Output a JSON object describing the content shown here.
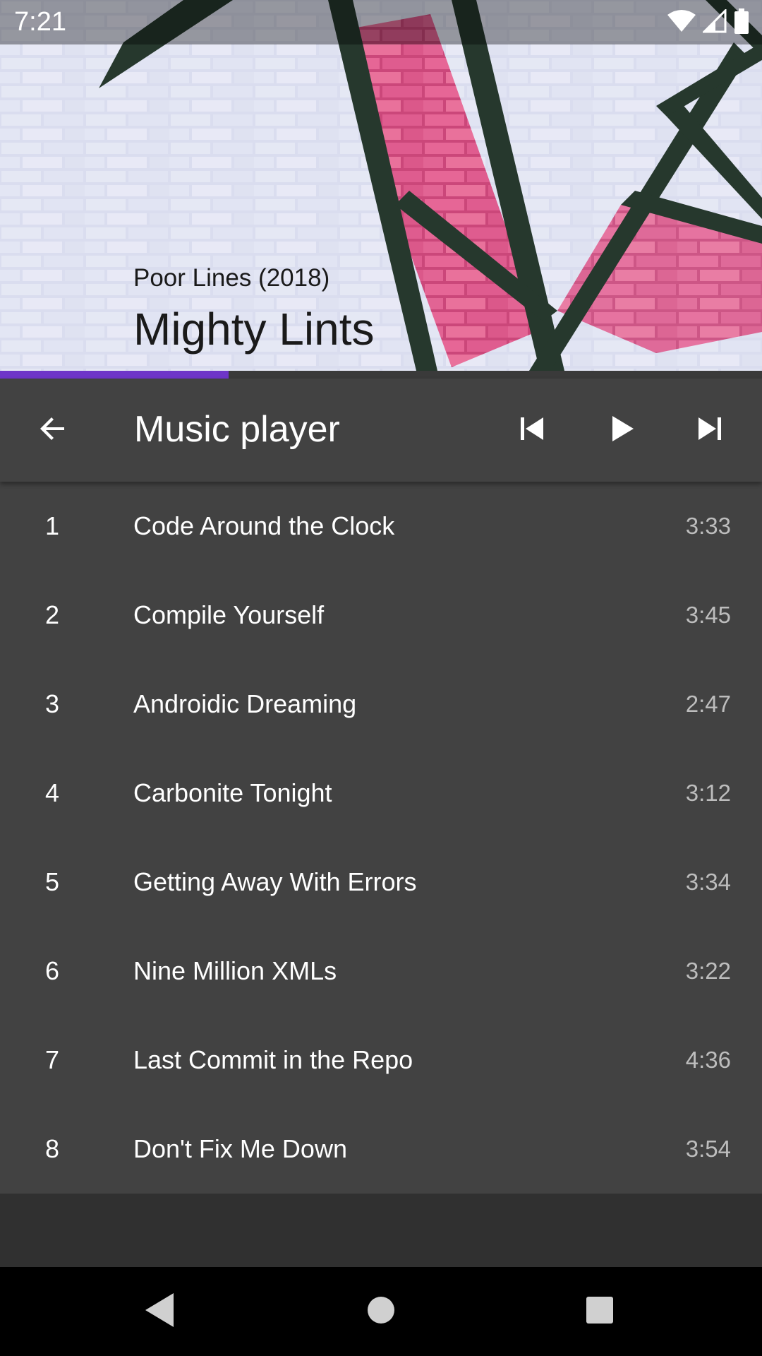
{
  "status_bar": {
    "time": "7:21",
    "icons": [
      "wifi-icon",
      "cell-signal-icon",
      "battery-icon"
    ]
  },
  "album": {
    "subtitle": "Poor Lines (2018)",
    "artist": "Mighty Lints"
  },
  "playback": {
    "progress": 0.3
  },
  "toolbar": {
    "title": "Music player",
    "back_icon": "arrow-back-icon",
    "prev_icon": "skip-previous-icon",
    "play_icon": "play-icon",
    "next_icon": "skip-next-icon"
  },
  "tracks": [
    {
      "number": "1",
      "title": "Code Around the Clock",
      "duration": "3:33"
    },
    {
      "number": "2",
      "title": "Compile Yourself",
      "duration": "3:45"
    },
    {
      "number": "3",
      "title": "Androidic Dreaming",
      "duration": "2:47"
    },
    {
      "number": "4",
      "title": "Carbonite Tonight",
      "duration": "3:12"
    },
    {
      "number": "5",
      "title": "Getting Away With Errors",
      "duration": "3:34"
    },
    {
      "number": "6",
      "title": "Nine Million XMLs",
      "duration": "3:22"
    },
    {
      "number": "7",
      "title": "Last Commit in the Repo",
      "duration": "4:36"
    },
    {
      "number": "8",
      "title": "Don't Fix Me Down",
      "duration": "3:54"
    }
  ],
  "nav_bar": {
    "icons": [
      "nav-back-icon",
      "nav-home-icon",
      "nav-recents-icon"
    ]
  },
  "colors": {
    "accent": "#6e35c8",
    "surface": "#424242",
    "background": "#303030",
    "secondary_text": "#bdbdbd"
  }
}
